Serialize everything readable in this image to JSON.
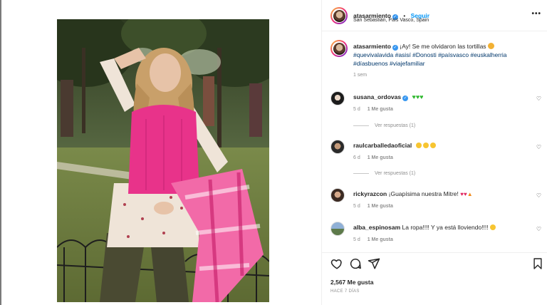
{
  "post": {
    "username": "atasarmiento",
    "follow_label": "Seguir",
    "location": "San Sebastián, País Vasco, Spain",
    "caption_text": "¡Ay! Se me olvidaron las tortillas",
    "hashtags_line1": "#quevivalavida #asisí #Donosti #paísvasco #euskalherria",
    "hashtags_line2": "#díasbuenos #viajefamiliar",
    "caption_age": "1 sem",
    "likes": "2,567 Me gusta",
    "time_ago": "HACE 7 DÍAS"
  },
  "comments": [
    {
      "username": "susana_ordovas",
      "verified": true,
      "text": "",
      "age": "5 d",
      "likes": "1 Me gusta",
      "replies": "Ver respuestas (1)"
    },
    {
      "username": "raulcarballedaoficial",
      "verified": false,
      "text": "",
      "age": "6 d",
      "likes": "1 Me gusta",
      "replies": "Ver respuestas (1)"
    },
    {
      "username": "rickyrazcon",
      "verified": false,
      "text": "¡Guapísima nuestra Mitre!",
      "age": "5 d",
      "likes": "1 Me gusta"
    },
    {
      "username": "alba_espinosam",
      "verified": false,
      "text": "La ropa!!!! Y ya está lloviendo!!!!",
      "age": "5 d",
      "likes": "1 Me gusta"
    }
  ],
  "icons": {
    "more": "more-options-icon",
    "like": "heart-icon",
    "comment": "comment-icon",
    "share": "share-icon",
    "save": "bookmark-icon"
  },
  "colors": {
    "link": "#00376b",
    "follow": "#0095f6",
    "muted": "#8e8e8e",
    "verified": "#3897f0"
  }
}
